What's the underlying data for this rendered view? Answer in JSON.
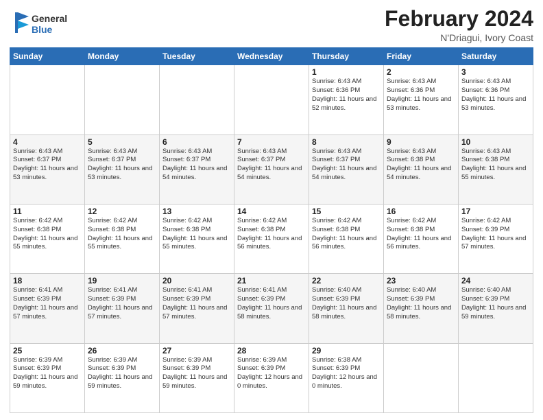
{
  "header": {
    "logo_general": "General",
    "logo_blue": "Blue",
    "title": "February 2024",
    "location": "N'Driagui, Ivory Coast"
  },
  "days_of_week": [
    "Sunday",
    "Monday",
    "Tuesday",
    "Wednesday",
    "Thursday",
    "Friday",
    "Saturday"
  ],
  "weeks": [
    [
      {
        "day": "",
        "info": ""
      },
      {
        "day": "",
        "info": ""
      },
      {
        "day": "",
        "info": ""
      },
      {
        "day": "",
        "info": ""
      },
      {
        "day": "1",
        "info": "Sunrise: 6:43 AM\nSunset: 6:36 PM\nDaylight: 11 hours\nand 52 minutes."
      },
      {
        "day": "2",
        "info": "Sunrise: 6:43 AM\nSunset: 6:36 PM\nDaylight: 11 hours\nand 53 minutes."
      },
      {
        "day": "3",
        "info": "Sunrise: 6:43 AM\nSunset: 6:36 PM\nDaylight: 11 hours\nand 53 minutes."
      }
    ],
    [
      {
        "day": "4",
        "info": "Sunrise: 6:43 AM\nSunset: 6:37 PM\nDaylight: 11 hours\nand 53 minutes."
      },
      {
        "day": "5",
        "info": "Sunrise: 6:43 AM\nSunset: 6:37 PM\nDaylight: 11 hours\nand 53 minutes."
      },
      {
        "day": "6",
        "info": "Sunrise: 6:43 AM\nSunset: 6:37 PM\nDaylight: 11 hours\nand 54 minutes."
      },
      {
        "day": "7",
        "info": "Sunrise: 6:43 AM\nSunset: 6:37 PM\nDaylight: 11 hours\nand 54 minutes."
      },
      {
        "day": "8",
        "info": "Sunrise: 6:43 AM\nSunset: 6:37 PM\nDaylight: 11 hours\nand 54 minutes."
      },
      {
        "day": "9",
        "info": "Sunrise: 6:43 AM\nSunset: 6:38 PM\nDaylight: 11 hours\nand 54 minutes."
      },
      {
        "day": "10",
        "info": "Sunrise: 6:43 AM\nSunset: 6:38 PM\nDaylight: 11 hours\nand 55 minutes."
      }
    ],
    [
      {
        "day": "11",
        "info": "Sunrise: 6:42 AM\nSunset: 6:38 PM\nDaylight: 11 hours\nand 55 minutes."
      },
      {
        "day": "12",
        "info": "Sunrise: 6:42 AM\nSunset: 6:38 PM\nDaylight: 11 hours\nand 55 minutes."
      },
      {
        "day": "13",
        "info": "Sunrise: 6:42 AM\nSunset: 6:38 PM\nDaylight: 11 hours\nand 55 minutes."
      },
      {
        "day": "14",
        "info": "Sunrise: 6:42 AM\nSunset: 6:38 PM\nDaylight: 11 hours\nand 56 minutes."
      },
      {
        "day": "15",
        "info": "Sunrise: 6:42 AM\nSunset: 6:38 PM\nDaylight: 11 hours\nand 56 minutes."
      },
      {
        "day": "16",
        "info": "Sunrise: 6:42 AM\nSunset: 6:38 PM\nDaylight: 11 hours\nand 56 minutes."
      },
      {
        "day": "17",
        "info": "Sunrise: 6:42 AM\nSunset: 6:39 PM\nDaylight: 11 hours\nand 57 minutes."
      }
    ],
    [
      {
        "day": "18",
        "info": "Sunrise: 6:41 AM\nSunset: 6:39 PM\nDaylight: 11 hours\nand 57 minutes."
      },
      {
        "day": "19",
        "info": "Sunrise: 6:41 AM\nSunset: 6:39 PM\nDaylight: 11 hours\nand 57 minutes."
      },
      {
        "day": "20",
        "info": "Sunrise: 6:41 AM\nSunset: 6:39 PM\nDaylight: 11 hours\nand 57 minutes."
      },
      {
        "day": "21",
        "info": "Sunrise: 6:41 AM\nSunset: 6:39 PM\nDaylight: 11 hours\nand 58 minutes."
      },
      {
        "day": "22",
        "info": "Sunrise: 6:40 AM\nSunset: 6:39 PM\nDaylight: 11 hours\nand 58 minutes."
      },
      {
        "day": "23",
        "info": "Sunrise: 6:40 AM\nSunset: 6:39 PM\nDaylight: 11 hours\nand 58 minutes."
      },
      {
        "day": "24",
        "info": "Sunrise: 6:40 AM\nSunset: 6:39 PM\nDaylight: 11 hours\nand 59 minutes."
      }
    ],
    [
      {
        "day": "25",
        "info": "Sunrise: 6:39 AM\nSunset: 6:39 PM\nDaylight: 11 hours\nand 59 minutes."
      },
      {
        "day": "26",
        "info": "Sunrise: 6:39 AM\nSunset: 6:39 PM\nDaylight: 11 hours\nand 59 minutes."
      },
      {
        "day": "27",
        "info": "Sunrise: 6:39 AM\nSunset: 6:39 PM\nDaylight: 11 hours\nand 59 minutes."
      },
      {
        "day": "28",
        "info": "Sunrise: 6:39 AM\nSunset: 6:39 PM\nDaylight: 12 hours\nand 0 minutes."
      },
      {
        "day": "29",
        "info": "Sunrise: 6:38 AM\nSunset: 6:39 PM\nDaylight: 12 hours\nand 0 minutes."
      },
      {
        "day": "",
        "info": ""
      },
      {
        "day": "",
        "info": ""
      }
    ]
  ]
}
